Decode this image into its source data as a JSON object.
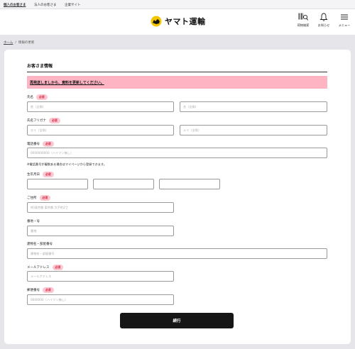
{
  "topbar": {
    "links": [
      "個人のお客さま",
      "法人のお客さま",
      "企業サイト"
    ]
  },
  "header": {
    "logo_text": "ヤマト運輸",
    "icons": [
      {
        "label": "荷物検索",
        "icon": "barcode-search-icon"
      },
      {
        "label": "お知らせ",
        "icon": "bell-icon"
      },
      {
        "label": "メニュー",
        "icon": "hamburger-menu-icon"
      }
    ]
  },
  "breadcrumb": {
    "home": "ホーム",
    "separator": "/",
    "current": "情報の更新"
  },
  "form": {
    "title": "お客さま情報",
    "alert": "再発送しましから、資料を更新してください。",
    "required_badge": "必須",
    "name": {
      "label": "氏名",
      "last_placeholder": "姓（全角）",
      "first_placeholder": "名（全角）"
    },
    "kana": {
      "label": "氏名フリガナ",
      "last_placeholder": "セイ（全角）",
      "first_placeholder": "メイ（全角）"
    },
    "phone": {
      "label": "電話番号",
      "placeholder": "0000000000（ハイフン無し）",
      "note": "※電話番号が複数ある場合はマイページから登録できます。"
    },
    "birthdate": {
      "label": "生年月日"
    },
    "address": {
      "label": "ご住所",
      "placeholder": "例)東京都 東京都 大手町2丁"
    },
    "house_number": {
      "label": "番地・号",
      "placeholder": "番地"
    },
    "building": {
      "label": "建物名・部屋番号",
      "placeholder": "建物名・部屋番号"
    },
    "email": {
      "label": "メールアドレス",
      "placeholder": "メールアドレス"
    },
    "postal": {
      "label": "郵便番号",
      "placeholder": "0000000（ハイフン無し）"
    },
    "submit_label": "続行"
  },
  "colors": {
    "alert_bg": "#ffb4c3",
    "badge_bg": "#f9c8d2",
    "badge_text": "#d6223b",
    "logo_yellow": "#f5c400",
    "button_bg": "#161616"
  }
}
